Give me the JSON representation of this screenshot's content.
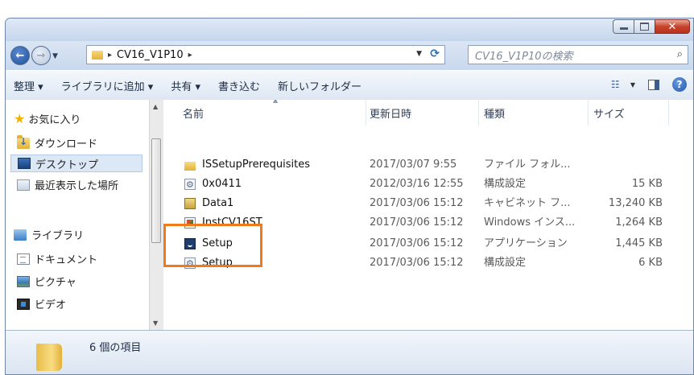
{
  "window": {
    "minimize_label": "",
    "maximize_label": "",
    "close_label": "✕"
  },
  "address": {
    "path_segment": "CV16_V1P10",
    "separator_glyph": "▸"
  },
  "search": {
    "placeholder": "CV16_V1P10の検索"
  },
  "toolbar": {
    "organize": "整理 ▾",
    "add_to_library": "ライブラリに追加 ▾",
    "share": "共有 ▾",
    "burn": "書き込む",
    "new_folder": "新しいフォルダー",
    "help": "?"
  },
  "sidebar": {
    "favorites": "お気に入り",
    "items": [
      {
        "label": "ダウンロード"
      },
      {
        "label": "デスクトップ"
      },
      {
        "label": "最近表示した場所"
      }
    ],
    "libraries": "ライブラリ",
    "library_items": [
      {
        "label": "ドキュメント"
      },
      {
        "label": "ピクチャ"
      },
      {
        "label": "ビデオ"
      }
    ]
  },
  "columns": {
    "name": "名前",
    "date": "更新日時",
    "type": "種類",
    "size": "サイズ"
  },
  "files": [
    {
      "name": "ISSetupPrerequisites",
      "date": "2017/03/07 9:55",
      "type": "ファイル フォル...",
      "size": "",
      "icon": "folder-icon"
    },
    {
      "name": "0x0411",
      "date": "2012/03/16 12:55",
      "type": "構成設定",
      "size": "15 KB",
      "icon": "settings-file-icon"
    },
    {
      "name": "Data1",
      "date": "2017/03/06 15:12",
      "type": "キャビネット フ...",
      "size": "13,240 KB",
      "icon": "cabinet-file-icon"
    },
    {
      "name": "InstCV16ST",
      "date": "2017/03/06 15:12",
      "type": "Windows インス...",
      "size": "1,264 KB",
      "icon": "installer-file-icon"
    },
    {
      "name": "Setup",
      "date": "2017/03/06 15:12",
      "type": "アプリケーション",
      "size": "1,445 KB",
      "icon": "application-icon"
    },
    {
      "name": "Setup",
      "date": "2017/03/06 15:12",
      "type": "構成設定",
      "size": "6 KB",
      "icon": "settings-file-icon"
    }
  ],
  "status": {
    "item_count": "6 個の項目"
  },
  "colors": {
    "highlight": "#f07a1a",
    "selection": "#dce8f6"
  }
}
